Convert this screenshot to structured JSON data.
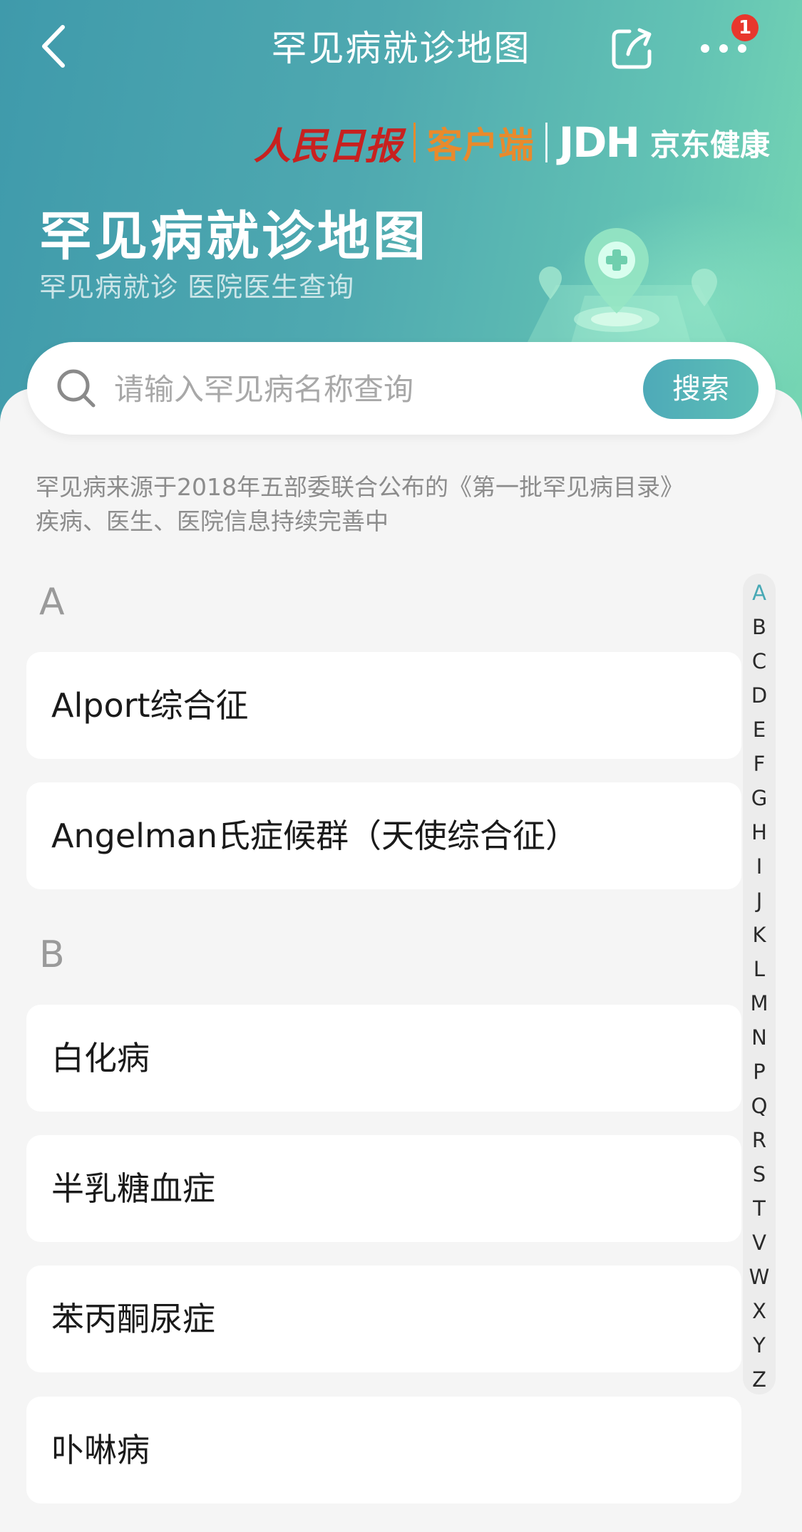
{
  "nav": {
    "title": "罕见病就诊地图",
    "badge_count": "1"
  },
  "brand": {
    "renmin": "人民日报",
    "client": "客户端",
    "jdh": "JDH",
    "jd_health": "京东健康"
  },
  "hero": {
    "title": "罕见病就诊地图",
    "subtitle": "罕见病就诊 医院医生查询"
  },
  "search": {
    "placeholder": "请输入罕见病名称查询",
    "button_label": "搜索"
  },
  "notice": {
    "line1": "罕见病来源于2018年五部委联合公布的《第一批罕见病目录》",
    "line2": "疾病、医生、医院信息持续完善中"
  },
  "sections": [
    {
      "letter": "A",
      "items": [
        "Alport综合征",
        "Angelman氏症候群（天使综合征）"
      ]
    },
    {
      "letter": "B",
      "items": [
        "白化病",
        "半乳糖血症",
        "苯丙酮尿症",
        "卟啉病"
      ]
    }
  ],
  "index": {
    "active": "A",
    "letters": [
      "A",
      "B",
      "C",
      "D",
      "E",
      "F",
      "G",
      "H",
      "I",
      "J",
      "K",
      "L",
      "M",
      "N",
      "P",
      "Q",
      "R",
      "S",
      "T",
      "V",
      "W",
      "X",
      "Y",
      "Z"
    ]
  },
  "colors": {
    "header_gradient_start": "#3f9aab",
    "header_gradient_end": "#76d6b3",
    "accent": "#48a9b5",
    "badge": "#e8372d",
    "renmin_red": "#c8211f",
    "client_orange": "#e98a2c"
  }
}
